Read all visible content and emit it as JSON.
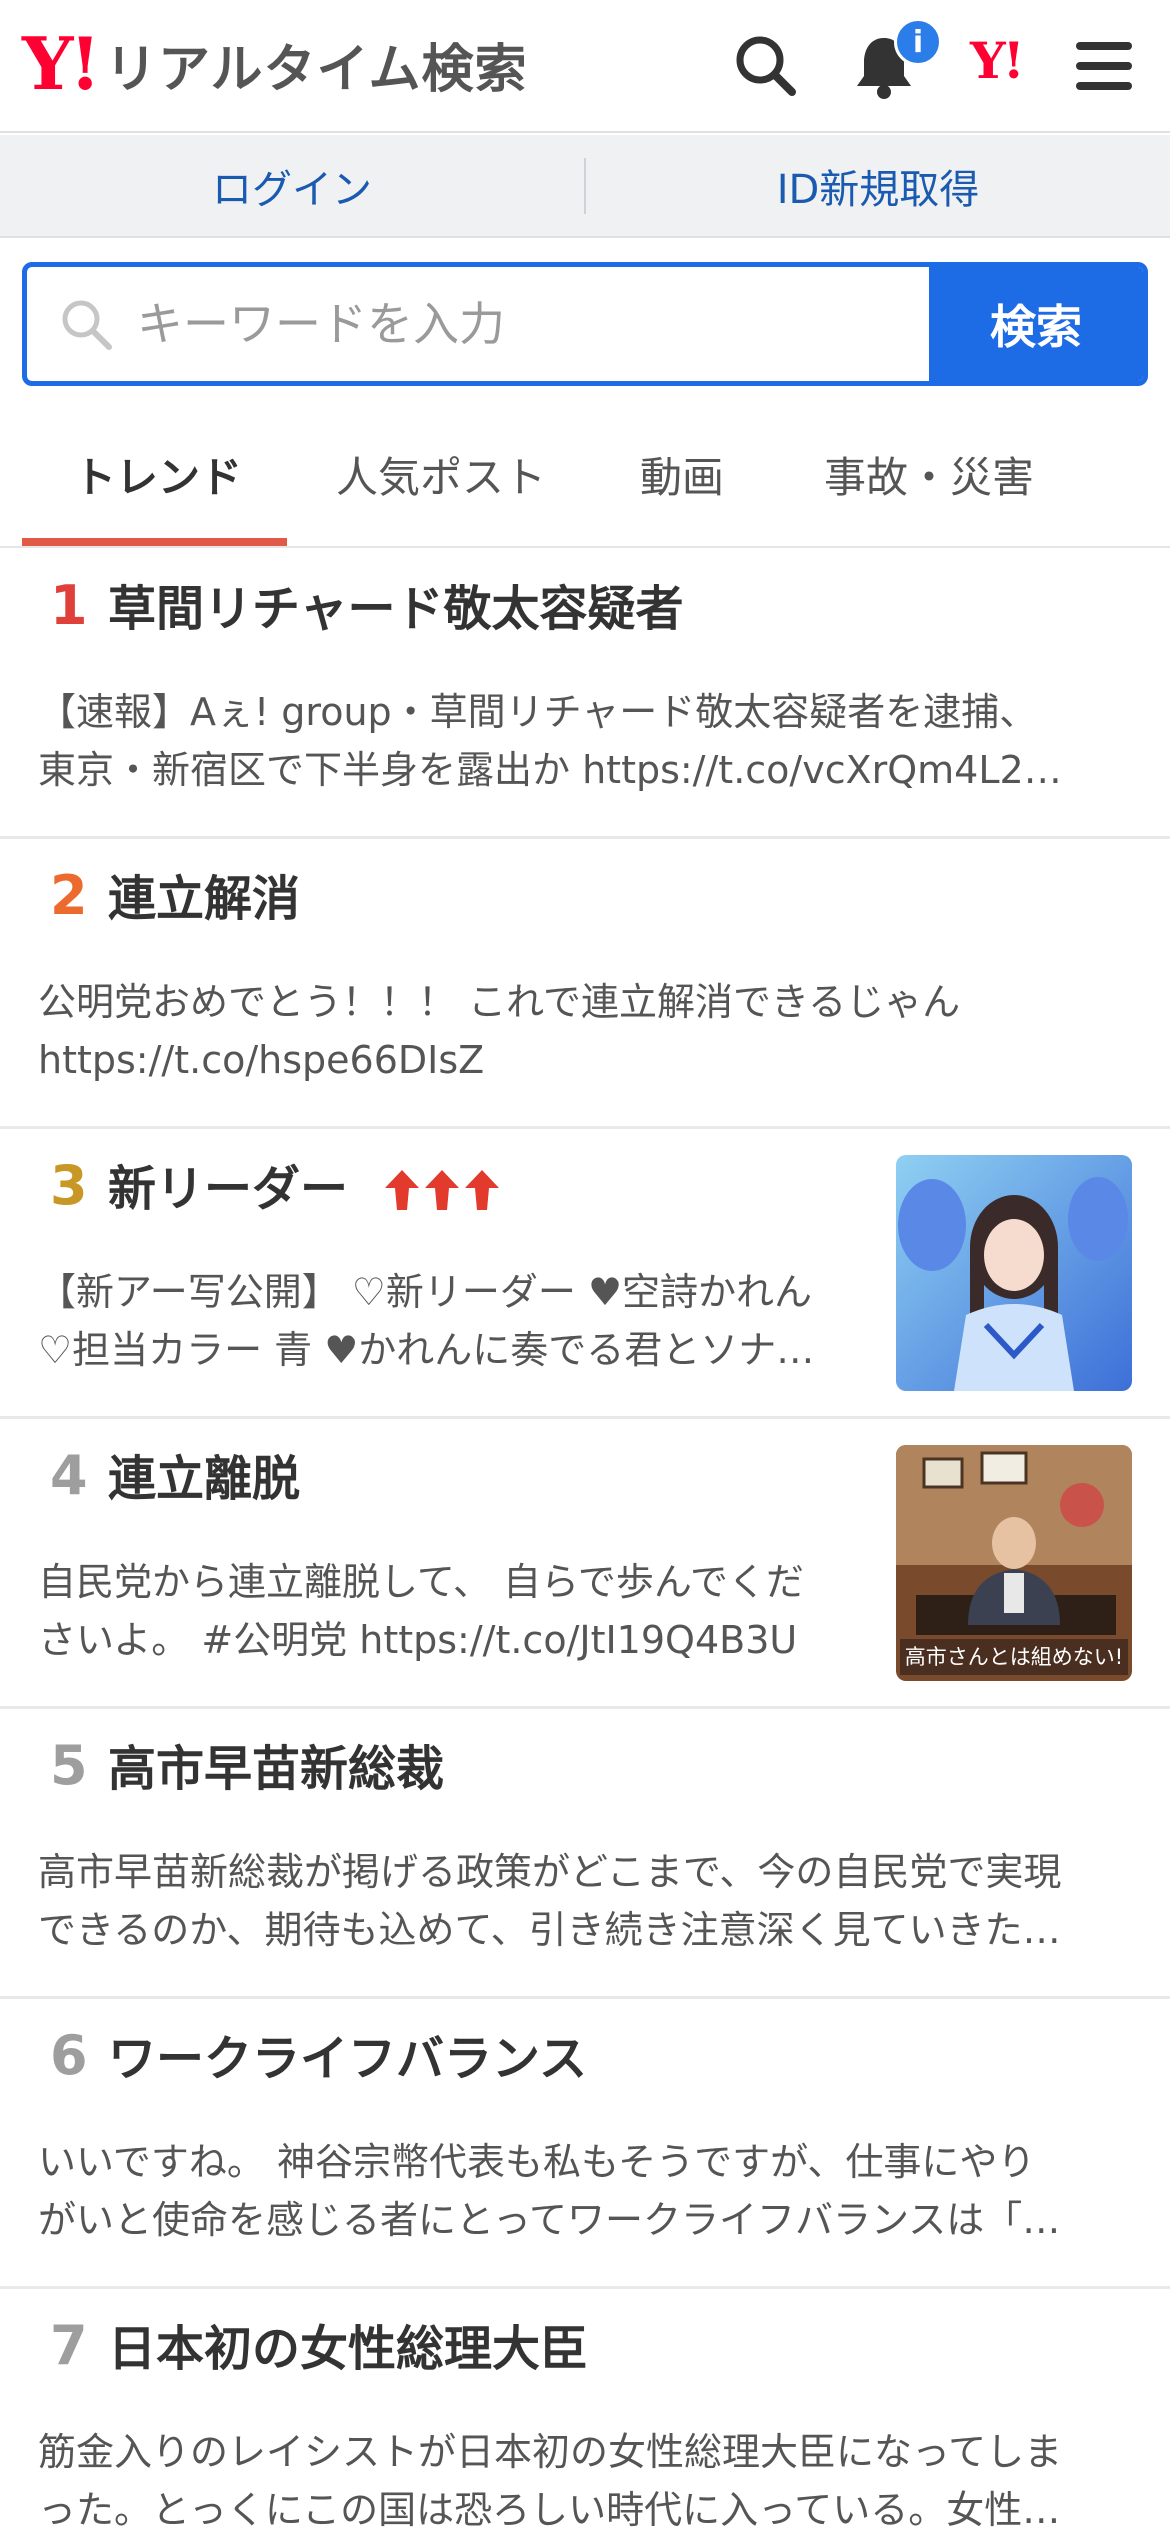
{
  "header": {
    "logo_mark": "Y!",
    "logo_text": "リアルタイム検索",
    "notification_badge": "i",
    "yj_mark": "Y!"
  },
  "loginbar": {
    "login": "ログイン",
    "register": "ID新規取得"
  },
  "search": {
    "placeholder": "キーワードを入力",
    "button": "検索"
  },
  "tabs": [
    {
      "label": "トレンド",
      "active": true
    },
    {
      "label": "人気ポスト",
      "active": false
    },
    {
      "label": "動画",
      "active": false
    },
    {
      "label": "事故・災害",
      "active": false
    }
  ],
  "colors": {
    "accent_blue": "#1e6be6",
    "link_blue": "#1a5ab0",
    "brand_red": "#ff0033",
    "tab_underline": "#e05a47",
    "rank1": "#e0403a",
    "rank2": "#ec6a2e",
    "rank3": "#c99725",
    "rank_other": "#9e9e9e",
    "trend_arrow": "#e23b2e"
  },
  "trends": [
    {
      "rank": "1",
      "title": "草間リチャード敬太容疑者",
      "desc_line1": "【速報】Aぇ! group・草間リチャード敬太容疑者を逮捕、",
      "desc_line2": "東京・新宿区で下半身を露出か https://t.co/vcXrQm4L2…"
    },
    {
      "rank": "2",
      "title": "連立解消",
      "desc_line1": "公明党おめでとう！！！ これで連立解消できるじゃん",
      "desc_line2": "https://t.co/hspe66DIsZ"
    },
    {
      "rank": "3",
      "title": "新リーダー",
      "trend_arrows": 3,
      "desc_line1": "【新アー写公開】 ♡新リーダー ♥空詩かれん",
      "desc_line2": "♡担当カラー 青 ♥かれんに奏でる君とソナ…",
      "thumbnail": "idol-photo"
    },
    {
      "rank": "4",
      "title": "連立離脱",
      "desc_line1": "自民党から連立離脱して、 自らで歩んでくだ",
      "desc_line2": "さいよ。 #公明党 https://t.co/JtI19Q4B3U",
      "thumbnail": "politician-photo",
      "thumbnail_caption": "高市さんとは組めない!"
    },
    {
      "rank": "5",
      "title": "高市早苗新総裁",
      "desc_line1": "高市早苗新総裁が掲げる政策がどこまで、今の自民党で実現",
      "desc_line2": "できるのか、期待も込めて、引き続き注意深く見ていきた…"
    },
    {
      "rank": "6",
      "title": "ワークライフバランス",
      "desc_line1": "いいですね。 神谷宗幣代表も私もそうですが、仕事にやり",
      "desc_line2": "がいと使命を感じる者にとってワークライフバランスは「…"
    },
    {
      "rank": "7",
      "title": "日本初の女性総理大臣",
      "desc_line1": "筋金入りのレイシストが日本初の女性総理大臣になってしま",
      "desc_line2": "った。とっくにこの国は恐ろしい時代に入っている。女性…"
    }
  ]
}
